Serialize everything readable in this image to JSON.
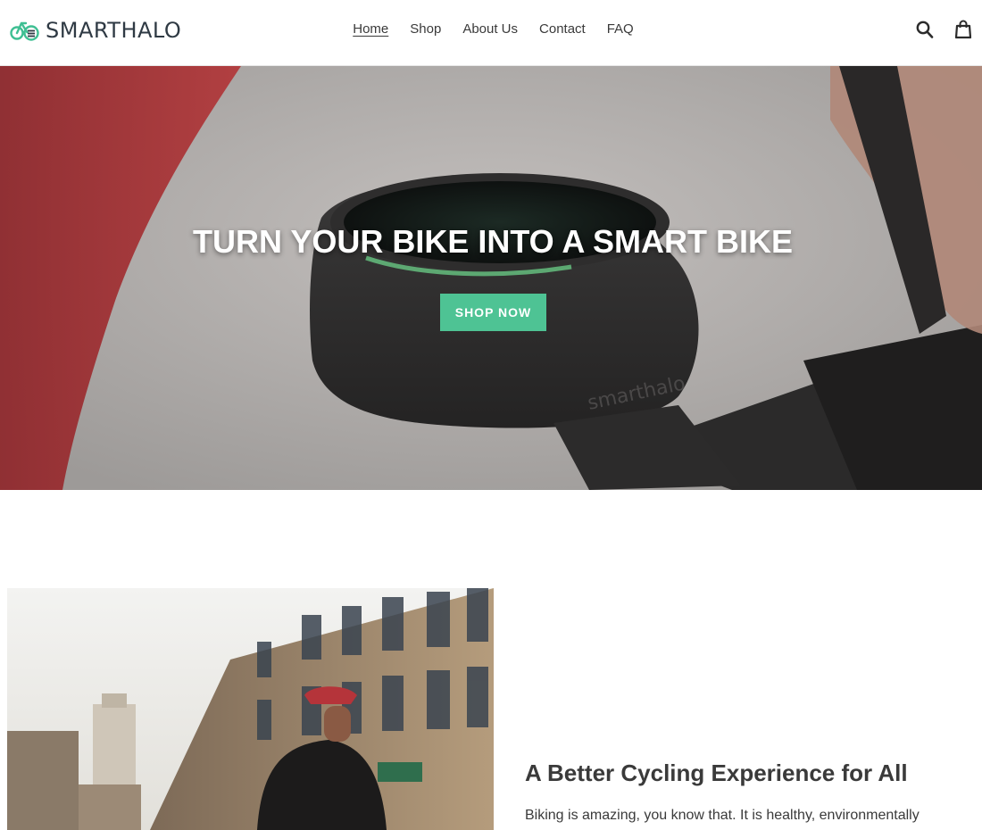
{
  "brand": {
    "name": "SMARTHALO",
    "accent": "#4ec394",
    "logo_icon": "bike-icon"
  },
  "nav": {
    "items": [
      {
        "label": "Home",
        "active": true
      },
      {
        "label": "Shop"
      },
      {
        "label": "About Us"
      },
      {
        "label": "Contact"
      },
      {
        "label": "FAQ"
      }
    ]
  },
  "header_icons": {
    "search": "search-icon",
    "cart": "cart-icon"
  },
  "hero": {
    "title": "TURN YOUR BIKE INTO A SMART BIKE",
    "button_label": "SHOP NOW",
    "button_color": "#4ec394"
  },
  "feature": {
    "title": "A Better Cycling Experience for All",
    "text": "Biking is amazing, you know that. It is healthy, environmentally"
  }
}
